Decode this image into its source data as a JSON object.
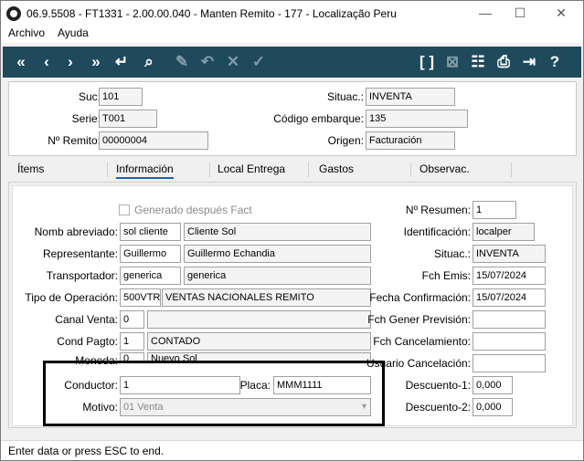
{
  "window": {
    "title": "06.9.5508 - FT1331 - 2.00.00.040 - Manten Remito - 177 - Localização Peru"
  },
  "menu": {
    "items": [
      "Archivo",
      "Ayuda"
    ]
  },
  "toolbar": {
    "icons": [
      "first-icon",
      "prev-icon",
      "next-icon",
      "last-icon",
      "enter-icon",
      "search-icon",
      "edit-icon",
      "undo-icon",
      "cancel-icon",
      "confirm-icon",
      "brackets-icon",
      "clear-icon",
      "tree-icon",
      "print-icon",
      "exit-icon",
      "help-icon"
    ],
    "brackets_label": "[ ]",
    "help_label": "?"
  },
  "header": {
    "suc_label": "Suc:",
    "suc_value": "101",
    "serie_label": "Serie:",
    "serie_value": "T001",
    "remito_label": "Nº Remito:",
    "remito_value": "00000004",
    "situac_label": "Situac.:",
    "situac_value": "INVENTA",
    "embarque_label": "Código embarque:",
    "embarque_value": "135",
    "origen_label": "Origen:",
    "origen_value": "Facturación"
  },
  "tabs": [
    "Ítems",
    "Información",
    "Local Entrega",
    "Gastos",
    "Observac."
  ],
  "active_tab": "Información",
  "info": {
    "generado_label": "Generado después Fact",
    "nombre_label": "Nomb abreviado:",
    "nombre_code": "sol cliente",
    "nombre_desc": "Cliente Sol",
    "repres_label": "Representante:",
    "repres_code": "Guillermo",
    "repres_desc": "Guillermo Echandia",
    "transp_label": "Transportador:",
    "transp_code": "generica",
    "transp_desc": "generica",
    "tipo_label": "Tipo de Operación:",
    "tipo_code": "500VTR",
    "tipo_desc": "VENTAS NACIONALES REMITO",
    "canal_label": "Canal Venta:",
    "canal_code": "0",
    "canal_desc": "",
    "cond_label": "Cond Pagto:",
    "cond_code": "1",
    "cond_desc": "CONTADO",
    "moneda_label": "Moneda:",
    "moneda_code": "0",
    "moneda_desc": "Nuevo Sol",
    "conductor_label": "Conductor:",
    "conductor_value": "1",
    "placa_label": "Placa:",
    "placa_value": "MMM1111",
    "motivo_label": "Motivo:",
    "motivo_value": "01 Venta",
    "resumen_label": "Nº Resumen:",
    "resumen_value": "1",
    "ident_label": "Identificación:",
    "ident_value": "localper",
    "situac_label": "Situac.:",
    "situac_value": "INVENTA",
    "emis_label": "Fch Emis:",
    "emis_value": "15/07/2024",
    "confirm_label": "Fecha Confirmación:",
    "confirm_value": "15/07/2024",
    "prevision_label": "Fch Gener Previsión:",
    "prevision_value": "",
    "cancel_label": "Fch Cancelamiento:",
    "cancel_value": "",
    "usuario_label": "Usuario Cancelación:",
    "usuario_value": "",
    "desc1_label": "Descuento-1:",
    "desc1_value": "0,000",
    "desc2_label": "Descuento-2:",
    "desc2_value": "0,000"
  },
  "status": {
    "text": "Enter data or press ESC to end."
  }
}
